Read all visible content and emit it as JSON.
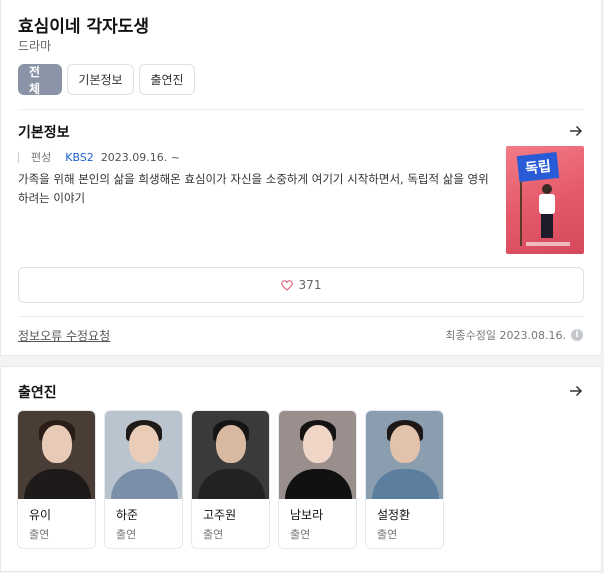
{
  "header": {
    "title": "효심이네 각자도생",
    "subtitle": "드라마",
    "tabs": [
      "전체",
      "기본정보",
      "출연진"
    ]
  },
  "basic_info": {
    "section_title": "기본정보",
    "schedule_label": "편성",
    "network": "KBS2",
    "air_date": "2023.09.16. ~",
    "description": "가족을 위해 본인의 삶을 희생해온 효심이가 자신을 소중하게 여기기 시작하면서, 독립적 삶을 영위하려는 이야기",
    "poster_text": "독립",
    "like_count": "371",
    "report_link": "정보오류 수정요청",
    "last_updated": "최종수정일 2023.08.16."
  },
  "cast": {
    "section_title": "출연진",
    "members": [
      {
        "name": "유이",
        "role": "출연"
      },
      {
        "name": "하준",
        "role": "출연"
      },
      {
        "name": "고주원",
        "role": "출연"
      },
      {
        "name": "남보라",
        "role": "출연"
      },
      {
        "name": "설정환",
        "role": "출연"
      }
    ]
  },
  "icons": {
    "arrow": "arrow-right-icon",
    "heart": "heart-icon",
    "info": "info-icon"
  },
  "colors": {
    "active_tab": "#8a94a6",
    "network_link": "#1b5fd1",
    "heart": "#e0566a"
  }
}
